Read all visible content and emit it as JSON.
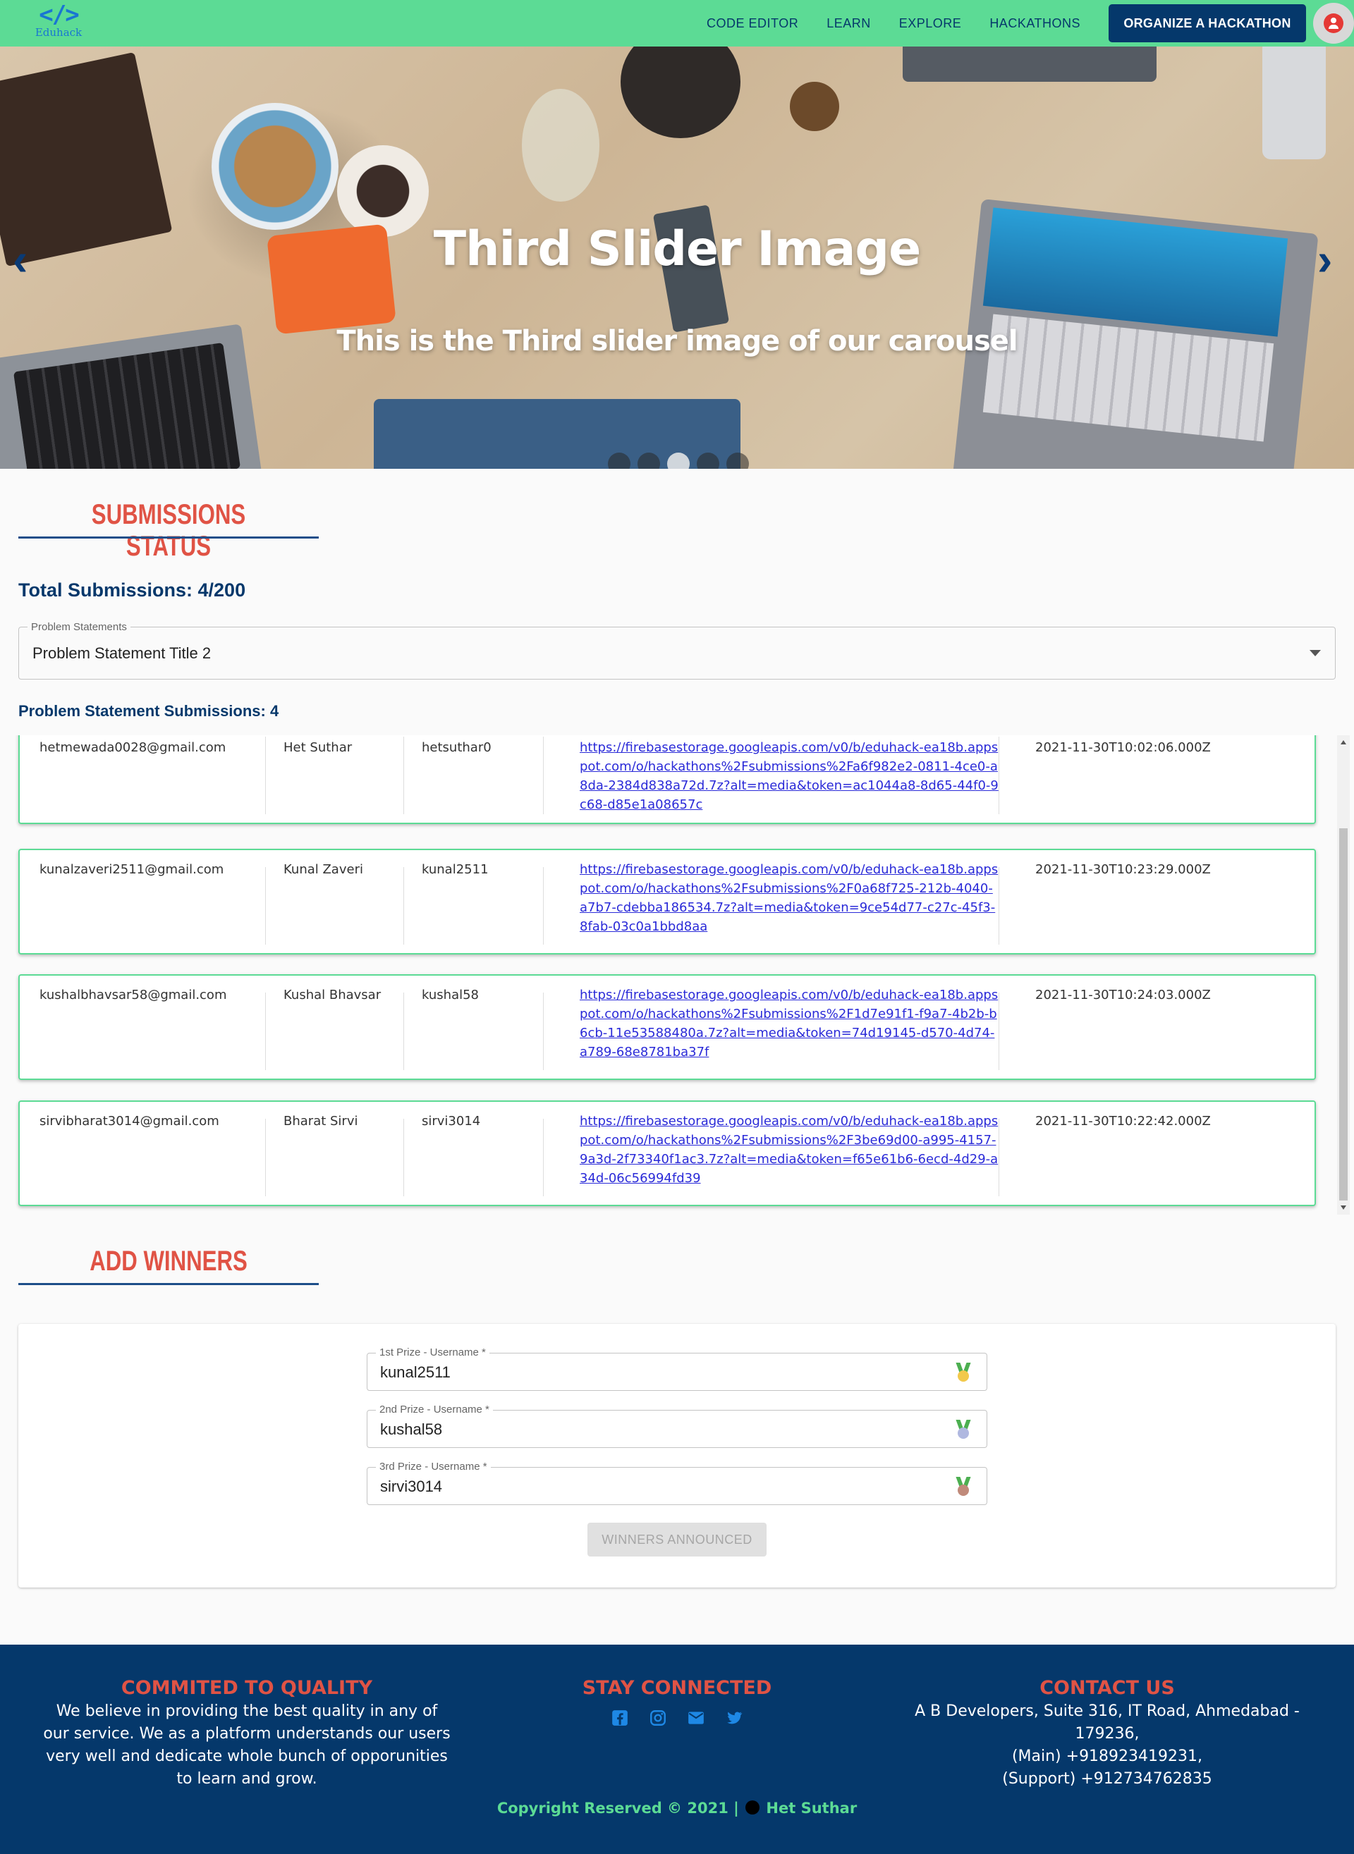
{
  "navbar": {
    "logo_text": "Eduhack",
    "logo_mark": "</>",
    "links": [
      "CODE EDITOR",
      "LEARN",
      "EXPLORE",
      "HACKATHONS"
    ],
    "cta": "ORGANIZE A HACKATHON"
  },
  "hero": {
    "title": "Third Slider Image",
    "subtitle": "This is the Third slider image of our carousel",
    "prev": "‹",
    "next": "›",
    "slide_count": 5,
    "active_slide": 3
  },
  "submissions": {
    "heading": "SUBMISSIONS STATUS",
    "total": "Total Submissions: 4/200",
    "select_label": "Problem Statements",
    "select_value": "Problem Statement Title 2",
    "ps_count": "Problem Statement Submissions: 4",
    "rows": [
      {
        "email": "hetmewada0028@gmail.com",
        "name": "Het Suthar",
        "username": "hetsuthar0",
        "link": "https://firebasestorage.googleapis.com/v0/b/eduhack-ea18b.appspot.com/o/hackathons%2Fsubmissions%2Fa6f982e2-0811-4ce0-a8da-2384d838a72d.7z?alt=media&token=ac1044a8-8d65-44f0-9c68-d85e1a08657c",
        "time": "2021-11-30T10:02:06.000Z"
      },
      {
        "email": "kunalzaveri2511@gmail.com",
        "name": "Kunal Zaveri",
        "username": "kunal2511",
        "link": "https://firebasestorage.googleapis.com/v0/b/eduhack-ea18b.appspot.com/o/hackathons%2Fsubmissions%2F0a68f725-212b-4040-a7b7-cdebba186534.7z?alt=media&token=9ce54d77-c27c-45f3-8fab-03c0a1bbd8aa",
        "time": "2021-11-30T10:23:29.000Z"
      },
      {
        "email": "kushalbhavsar58@gmail.com",
        "name": "Kushal Bhavsar",
        "username": "kushal58",
        "link": "https://firebasestorage.googleapis.com/v0/b/eduhack-ea18b.appspot.com/o/hackathons%2Fsubmissions%2F1d7e91f1-f9a7-4b2b-b6cb-11e53588480a.7z?alt=media&token=74d19145-d570-4d74-a789-68e8781ba37f",
        "time": "2021-11-30T10:24:03.000Z"
      },
      {
        "email": "sirvibharat3014@gmail.com",
        "name": "Bharat Sirvi",
        "username": "sirvi3014",
        "link": "https://firebasestorage.googleapis.com/v0/b/eduhack-ea18b.appspot.com/o/hackathons%2Fsubmissions%2F3be69d00-a995-4157-9a3d-2f73340f1ac3.7z?alt=media&token=f65e61b6-6ecd-4d29-a34d-06c56994fd39",
        "time": "2021-11-30T10:22:42.000Z"
      }
    ]
  },
  "winners": {
    "heading": "ADD WINNERS",
    "fields": [
      {
        "label": "1st Prize - Username *",
        "value": "kunal2511",
        "medal": "gold-medal-icon",
        "color": "#f2c94c"
      },
      {
        "label": "2nd Prize - Username *",
        "value": "kushal58",
        "medal": "silver-medal-icon",
        "color": "#b0b8e0"
      },
      {
        "label": "3rd Prize - Username *",
        "value": "sirvi3014",
        "medal": "bronze-medal-icon",
        "color": "#c08a7a"
      }
    ],
    "button": "WINNERS ANNOUNCED"
  },
  "footer": {
    "quality_title": "COMMITED TO QUALITY",
    "quality_text": "We believe in providing the best quality in any of our service. We as a platform understands our users very well and dedicate whole bunch of opporunities to learn and grow.",
    "connect_title": "STAY CONNECTED",
    "socials": [
      "facebook-icon",
      "instagram-icon",
      "mail-icon",
      "twitter-icon"
    ],
    "contact_title": "CONTACT US",
    "contact_address": "A B Developers, Suite 316, IT Road, Ahmedabad - 179236,",
    "contact_main": "(Main) +918923419231,",
    "contact_support": "(Support) +912734762835",
    "copyright_prefix": "Copyright Reserved © 2021 |",
    "copyright_name": "Het Suthar"
  },
  "colors": {
    "nav_green": "#5cdb95",
    "navy": "#05386b",
    "heading_red": "#e05345"
  }
}
